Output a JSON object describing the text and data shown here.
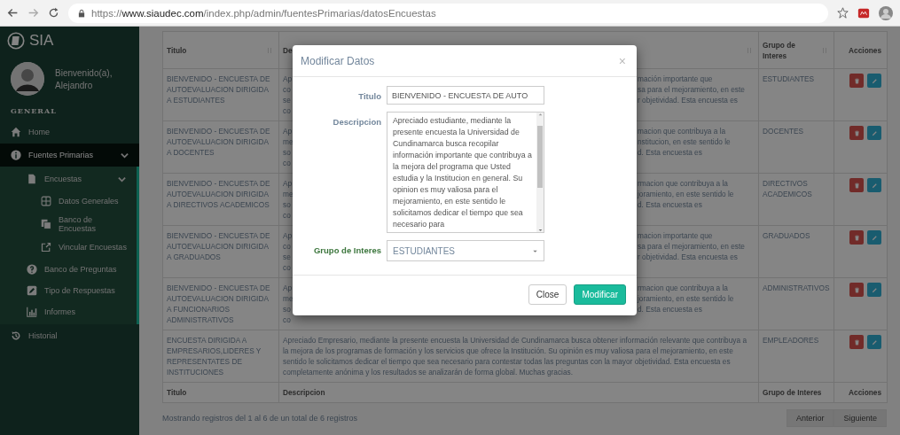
{
  "browser": {
    "url": "https://**www.siaudec.com**/index.php/admin/fuentesPrimarias/datosEncuestas"
  },
  "sidebar": {
    "brand": "SIA",
    "greeting": "Bienvenido(a),",
    "user": "Alejandro",
    "section": "GENERAL",
    "items": [
      {
        "label": "Home",
        "selected": false
      },
      {
        "label": "Fuentes Primarias",
        "selected": true,
        "expanded": true,
        "children": [
          {
            "label": "Encuestas",
            "selected": false,
            "expanded": true,
            "children": [
              {
                "label": "Datos Generales",
                "selected": false
              },
              {
                "label": "Banco de Encuestas",
                "selected": false
              },
              {
                "label": "Vincular Encuestas",
                "selected": false
              }
            ]
          },
          {
            "label": "Banco de Preguntas",
            "selected": false
          },
          {
            "label": "Tipo de Respuestas",
            "selected": false
          },
          {
            "label": "Informes",
            "selected": false
          }
        ]
      },
      {
        "label": "Historial",
        "selected": false
      }
    ]
  },
  "table": {
    "columns": [
      "Titulo",
      "De",
      "Grupo de Interes",
      "Acciones"
    ],
    "rows": [
      {
        "title": "BIENVENIDO - ENCUESTA DE AUTOEVALUACION DIRIGIDA A ESTUDIANTES",
        "desc_start": [
          "Ap",
          "co",
          "se",
          "co"
        ],
        "desc_end": [
          "mación importante que",
          "sa para el mejoramiento, en este",
          "r objetividad. Esta encuesta es"
        ],
        "group": "ESTUDIANTES"
      },
      {
        "title": "BIENVENIDO - ENCUESTA DE AUTOEVALUACION DIRIGIDA A DOCENTES",
        "desc_start": [
          "Ap",
          "me",
          "so",
          "co"
        ],
        "desc_end": [
          "macion que contribuya a la",
          "nstitucion, en este sentido le",
          "d. Esta encuesta es"
        ],
        "group": "DOCENTES"
      },
      {
        "title": "BIENVENIDO - ENCUESTA DE AUTOEVALUACION DIRIGIDA A DIRECTIVOS ACADEMICOS",
        "desc_start": [
          "Ap",
          "me",
          "so",
          "co"
        ],
        "desc_end": [
          "rmacion que contribuya a la",
          "joramiento, en este sentido le",
          "d. Esta encuesta es"
        ],
        "group": "DIRECTIVOS ACADEMICOS"
      },
      {
        "title": "BIENVENIDO - ENCUESTA DE AUTOEVALUACION DIRIGIDA A GRADUADOS",
        "desc_start": [
          "Ap",
          "co",
          "se",
          "co"
        ],
        "desc_end": [
          "macion importante que",
          "sa para el mejoramiento, en este",
          "r objetividad. Esta encuesta es"
        ],
        "group": "GRADUADOS"
      },
      {
        "title": "BIENVENIDO - ENCUESTA DE AUTOEVALUACION DIRIGIDA A FUNCIONARIOS ADMINISTRATIVOS",
        "desc_start": [
          "Ap",
          "me",
          "so",
          "co"
        ],
        "desc_end": [
          "rmacion que contribuya a la",
          "joramiento, en este sentido le",
          "d. Esta encuesta es"
        ],
        "group": "ADMINISTRATIVOS"
      },
      {
        "title": "ENCUESTA DIRIGIDA A EMPRESARIOS,LIDERES Y REPRESENTATES DE INSTITUCIONES",
        "description": "Apreciado Empresario, mediante la presente encuesta la Universidad de Cundinamarca busca obtener información relevante que contribuya a la mejora de los programas de formación y los servicios que ofrece la Institución. Su opinión es muy valiosa para el mejoramiento, en este sentido le solicitamos dedicar el tiempo que sea necesario para contestar todas las preguntas con la mayor objetividad. Esta encuesta es completamente anónima y los resultados se analizarán de forma global. Muchas gracias.",
        "group": "EMPLEADORES"
      }
    ],
    "footer_columns": [
      "Titulo",
      "Descripcion",
      "Grupo de Interes",
      "Acciones"
    ],
    "info": "Mostrando registros del 1 al 6 de un total de 6 registros",
    "pagination": [
      {
        "label": "Anterior",
        "disabled": true
      },
      {
        "label": "Siguiente",
        "disabled": true
      }
    ]
  },
  "modal": {
    "title": "Modificar Datos",
    "close": "×",
    "fields": [
      {
        "kind": "input",
        "label": "Titulo",
        "value": "BIENVENIDO - ENCUESTA DE AUTO"
      },
      {
        "kind": "textarea",
        "label": "Descripcion",
        "value": "Apreciado estudiante, mediante la presente encuesta la Universidad de Cundinamarca busca recopilar información importante que contribuya a la mejora del programa que Usted estudia y la Institucion en general. Su opinion es muy valiosa para el mejoramiento, en este sentido le solicitamos dedicar el tiempo que sea necesario para"
      },
      {
        "kind": "select",
        "label": "Grupo de Interes",
        "value": "ESTUDIANTES",
        "valid": true
      }
    ],
    "buttons": [
      {
        "label": "Close",
        "kind": "default"
      },
      {
        "label": "Modificar",
        "kind": "primary"
      }
    ]
  }
}
